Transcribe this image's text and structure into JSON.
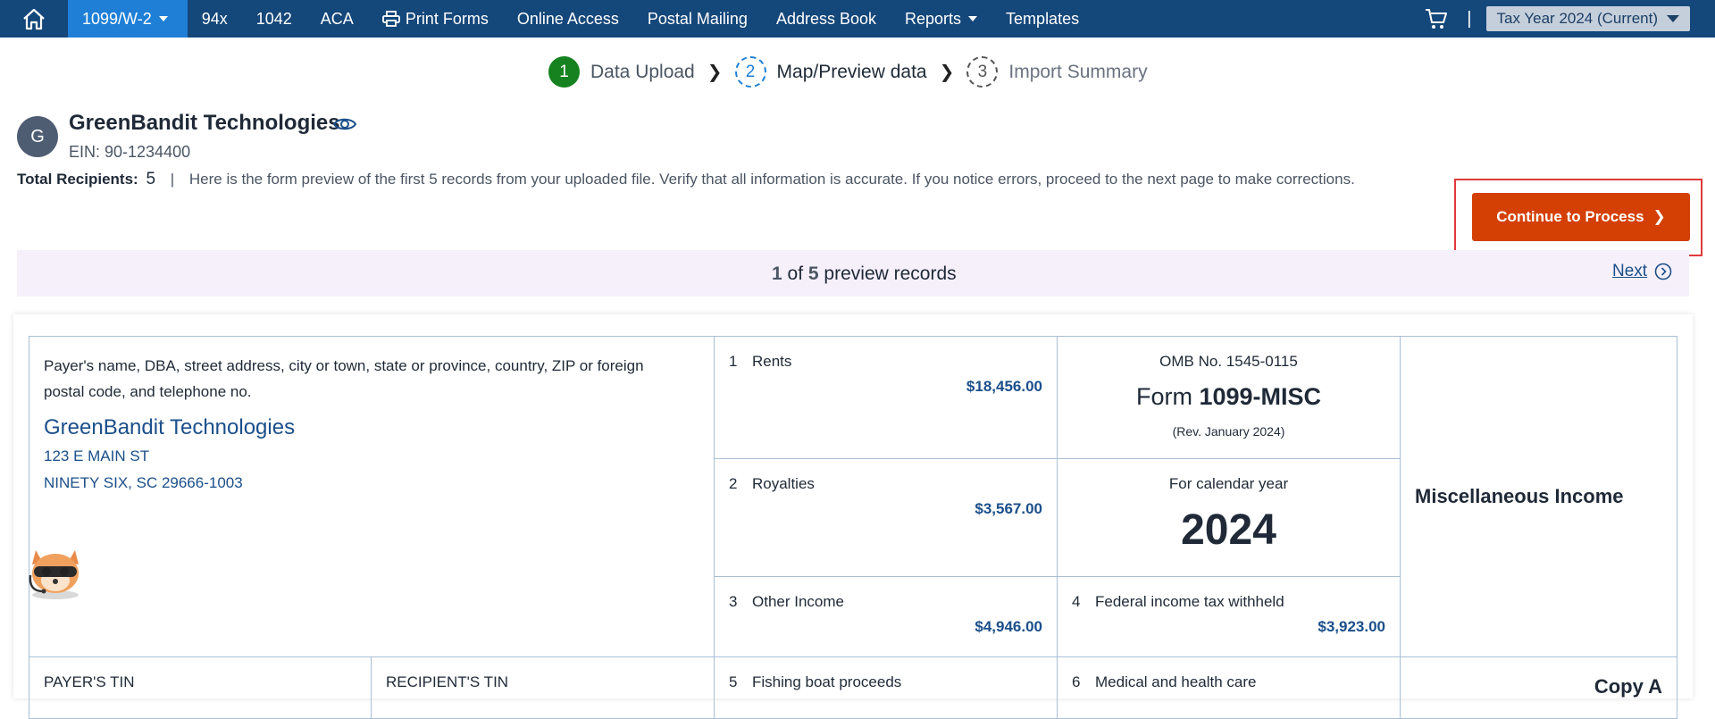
{
  "nav": {
    "items": [
      {
        "label": "1099/W-2",
        "active": true,
        "dropdown": true
      },
      {
        "label": "94x"
      },
      {
        "label": "1042"
      },
      {
        "label": "ACA"
      },
      {
        "label": "Print Forms",
        "icon": "printer-icon"
      },
      {
        "label": "Online Access"
      },
      {
        "label": "Postal Mailing"
      },
      {
        "label": "Address Book"
      },
      {
        "label": "Reports",
        "dropdown": true
      },
      {
        "label": "Templates"
      }
    ],
    "separator": "|",
    "tax_year": "Tax Year 2024 (Current)",
    "colors": {
      "bar": "#14477a",
      "active": "#1f7fd6"
    }
  },
  "stepper": {
    "steps": [
      {
        "number": "1",
        "label": "Data Upload",
        "state": "done"
      },
      {
        "number": "2",
        "label": "Map/Preview data",
        "state": "current"
      },
      {
        "number": "3",
        "label": "Import Summary",
        "state": "todo"
      }
    ]
  },
  "company": {
    "initial": "G",
    "name": "GreenBandit Technologies",
    "ein": "EIN: 90-1234400"
  },
  "summary": {
    "total_label": "Total Recipients:",
    "total_count": "5",
    "separator": "|",
    "message": "Here is the form preview of the first 5 records from your uploaded file. Verify that all information is accurate. If you notice errors, proceed to the next page to make corrections."
  },
  "actions": {
    "continue_label": "Continue to Process",
    "continue_color": "#d43f04"
  },
  "preview": {
    "current": "1",
    "of": "of",
    "total": "5",
    "suffix": "preview records",
    "next_label": "Next"
  },
  "form": {
    "payer_label": "Payer's name, DBA, street address, city or town, state or province, country, ZIP or foreign postal code, and telephone no.",
    "payer_name": "GreenBandit Technologies",
    "payer_address1": "123 E MAIN ST",
    "payer_address2": "NINETY SIX, SC 29666-1003",
    "omb": "OMB No. 1545-0115",
    "form_prefix": "Form",
    "form_name": "1099-MISC",
    "revision": "(Rev. January 2024)",
    "calendar_label": "For calendar year",
    "calendar_year": "2024",
    "title": "Miscellaneous Income",
    "copy": "Copy A",
    "boxes": {
      "b1": {
        "num": "1",
        "label": "Rents",
        "value": "$18,456.00"
      },
      "b2": {
        "num": "2",
        "label": "Royalties",
        "value": "$3,567.00"
      },
      "b3": {
        "num": "3",
        "label": "Other Income",
        "value": "$4,946.00"
      },
      "b4": {
        "num": "4",
        "label": "Federal income tax withheld",
        "value": "$3,923.00"
      },
      "b5": {
        "num": "5",
        "label": "Fishing boat proceeds"
      },
      "b6": {
        "num": "6",
        "label": "Medical and health care"
      }
    },
    "payer_tin_label": "PAYER'S TIN",
    "recipient_tin_label": "RECIPIENT'S TIN"
  }
}
